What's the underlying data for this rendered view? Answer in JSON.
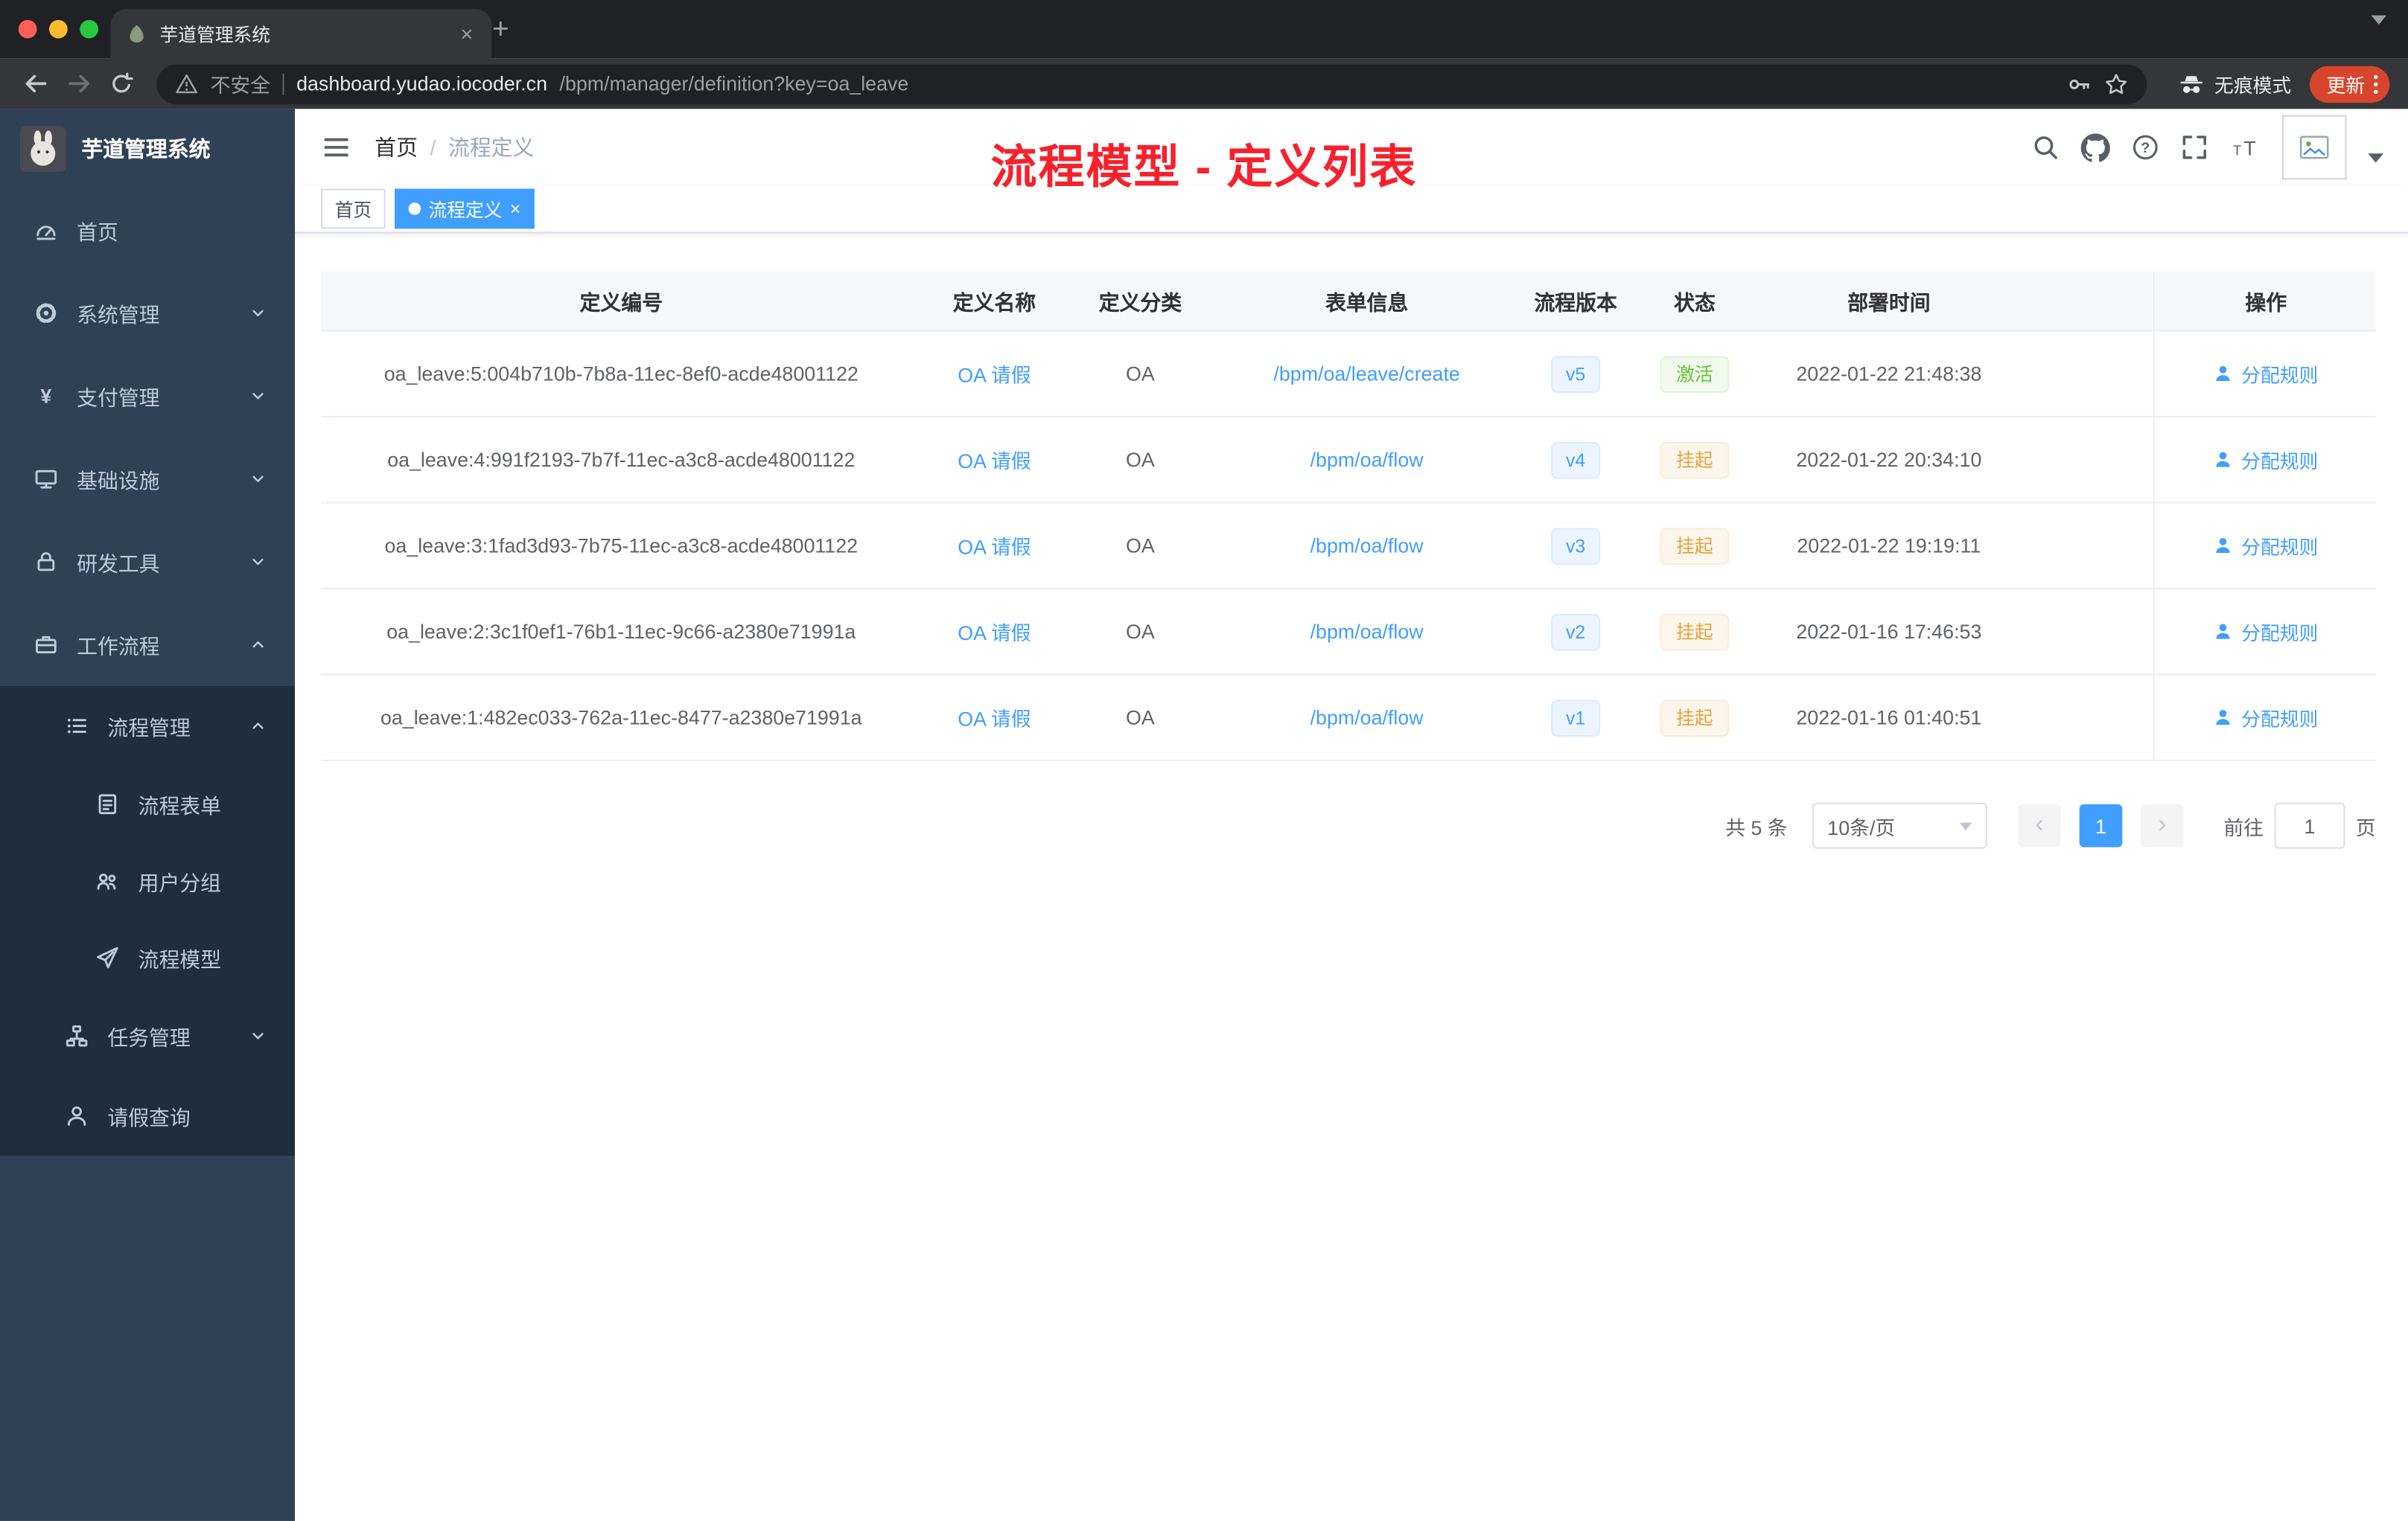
{
  "colors": {
    "accent": "#409eff",
    "success": "#67c23a",
    "warning": "#e6a23c",
    "annotation_red": "#f5222d",
    "sidebar_bg": "#304156",
    "submenu_bg": "#1f2d3d"
  },
  "browser": {
    "tab_title": "芋道管理系统",
    "security_label": "不安全",
    "url_host": "dashboard.yudao.iocoder.cn",
    "url_path": "/bpm/manager/definition?key=oa_leave",
    "incognito_label": "无痕模式",
    "update_label": "更新"
  },
  "sidebar": {
    "brand": "芋道管理系统",
    "menu": [
      {
        "label": "首页",
        "icon": "dashboard-icon",
        "level": 1
      },
      {
        "label": "系统管理",
        "icon": "gear-icon",
        "level": 1,
        "chevron": "down"
      },
      {
        "label": "支付管理",
        "icon": "yen-icon",
        "level": 1,
        "chevron": "down"
      },
      {
        "label": "基础设施",
        "icon": "monitor-icon",
        "level": 1,
        "chevron": "down"
      },
      {
        "label": "研发工具",
        "icon": "lock-icon",
        "level": 1,
        "chevron": "down"
      },
      {
        "label": "工作流程",
        "icon": "briefcase-icon",
        "level": 1,
        "chevron": "up"
      },
      {
        "label": "流程管理",
        "icon": "list-icon",
        "level": 2,
        "chevron": "up",
        "dark": true
      },
      {
        "label": "流程表单",
        "icon": "form-icon",
        "level": 3,
        "dark": true
      },
      {
        "label": "用户分组",
        "icon": "users-icon",
        "level": 3,
        "dark": true
      },
      {
        "label": "流程模型",
        "icon": "send-icon",
        "level": 3,
        "dark": true
      },
      {
        "label": "任务管理",
        "icon": "tree-icon",
        "level": 2,
        "chevron": "down",
        "dark": true
      },
      {
        "label": "请假查询",
        "icon": "user-icon",
        "level": 2,
        "dark": true
      }
    ]
  },
  "header": {
    "breadcrumb_home": "首页",
    "breadcrumb_sep": "/",
    "breadcrumb_current": "流程定义",
    "annotation": "流程模型 - 定义列表"
  },
  "tags": {
    "items": [
      {
        "label": "首页",
        "active": false,
        "closable": false
      },
      {
        "label": "流程定义",
        "active": true,
        "closable": true
      }
    ]
  },
  "table": {
    "columns": [
      "定义编号",
      "定义名称",
      "定义分类",
      "表单信息",
      "流程版本",
      "状态",
      "部署时间",
      "操作"
    ],
    "rows": [
      {
        "id": "oa_leave:5:004b710b-7b8a-11ec-8ef0-acde48001122",
        "name": "OA 请假",
        "category": "OA",
        "form": "/bpm/oa/leave/create",
        "version": "v5",
        "status": "激活",
        "status_type": "success",
        "deploy_time": "2022-01-22 21:48:38",
        "action": "分配规则"
      },
      {
        "id": "oa_leave:4:991f2193-7b7f-11ec-a3c8-acde48001122",
        "name": "OA 请假",
        "category": "OA",
        "form": "/bpm/oa/flow",
        "version": "v4",
        "status": "挂起",
        "status_type": "warning",
        "deploy_time": "2022-01-22 20:34:10",
        "action": "分配规则"
      },
      {
        "id": "oa_leave:3:1fad3d93-7b75-11ec-a3c8-acde48001122",
        "name": "OA 请假",
        "category": "OA",
        "form": "/bpm/oa/flow",
        "version": "v3",
        "status": "挂起",
        "status_type": "warning",
        "deploy_time": "2022-01-22 19:19:11",
        "action": "分配规则"
      },
      {
        "id": "oa_leave:2:3c1f0ef1-76b1-11ec-9c66-a2380e71991a",
        "name": "OA 请假",
        "category": "OA",
        "form": "/bpm/oa/flow",
        "version": "v2",
        "status": "挂起",
        "status_type": "warning",
        "deploy_time": "2022-01-16 17:46:53",
        "action": "分配规则"
      },
      {
        "id": "oa_leave:1:482ec033-762a-11ec-8477-a2380e71991a",
        "name": "OA 请假",
        "category": "OA",
        "form": "/bpm/oa/flow",
        "version": "v1",
        "status": "挂起",
        "status_type": "warning",
        "deploy_time": "2022-01-16 01:40:51",
        "action": "分配规则"
      }
    ]
  },
  "pagination": {
    "total": "共 5 条",
    "page_size": "10条/页",
    "prev": "‹",
    "page": "1",
    "next": "›",
    "goto_label": "前往",
    "goto_value": "1",
    "unit": "页"
  }
}
